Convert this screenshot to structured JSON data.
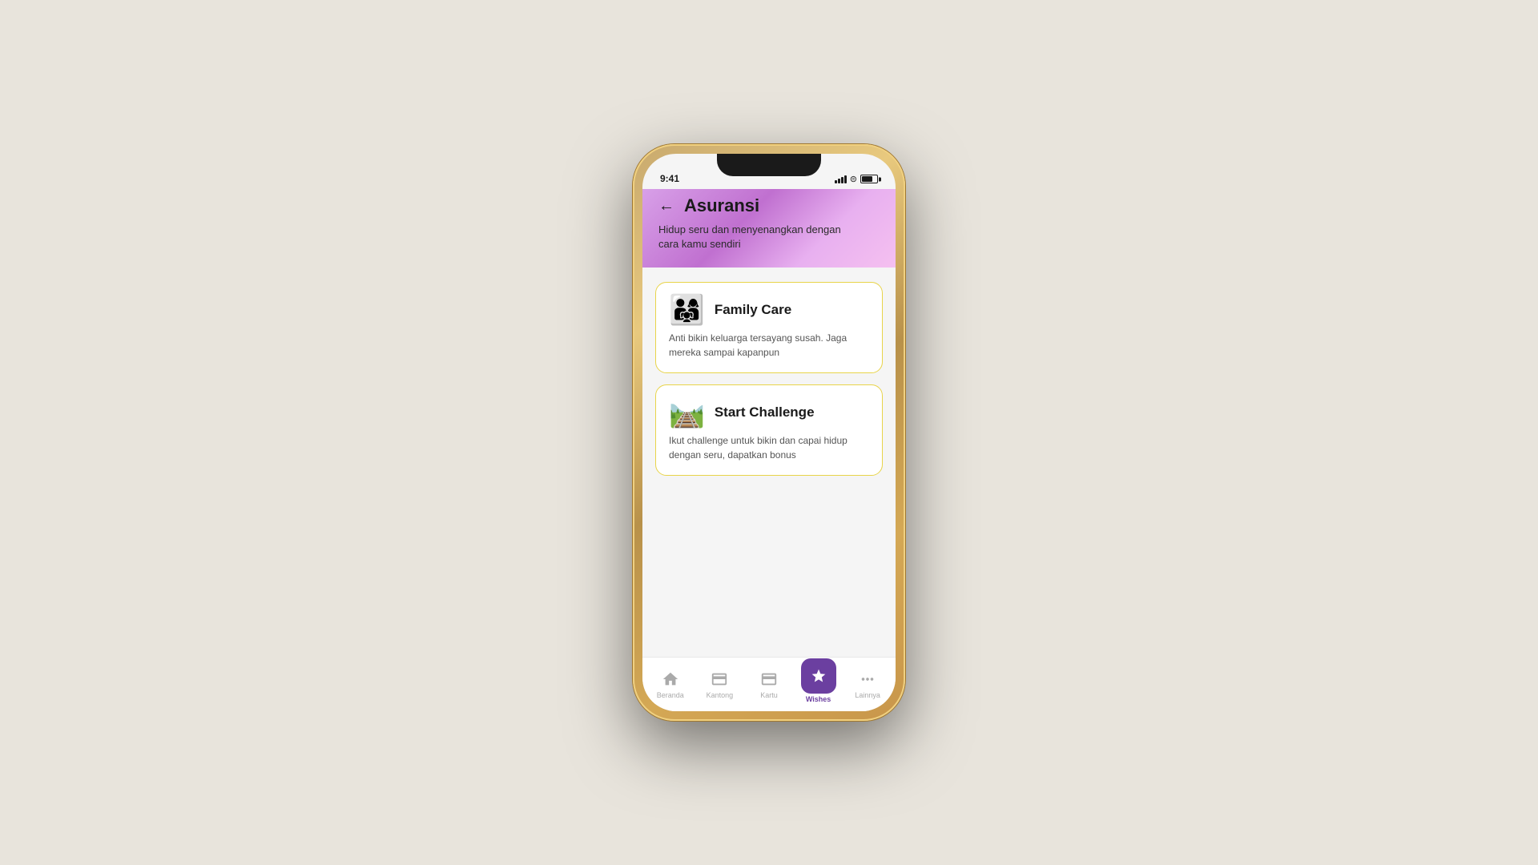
{
  "background": "#e8e4dc",
  "status_bar": {
    "time": "9:41"
  },
  "header": {
    "title": "Asuransi",
    "subtitle": "Hidup seru dan menyenangkan dengan\ncara kamu sendiri",
    "back_label": "←"
  },
  "cards": [
    {
      "id": "family-care",
      "emoji": "👨‍👩‍👧",
      "title": "Family Care",
      "description": "Anti bikin keluarga tersayang susah. Jaga mereka sampai kapanpun"
    },
    {
      "id": "start-challenge",
      "emoji": "🛤️",
      "title": "Start Challenge",
      "description": "Ikut challenge untuk bikin dan capai hidup dengan seru, dapatkan bonus"
    }
  ],
  "tab_bar": {
    "items": [
      {
        "id": "beranda",
        "label": "Beranda",
        "active": false
      },
      {
        "id": "kantong",
        "label": "Kantong",
        "active": false
      },
      {
        "id": "kartu",
        "label": "Kartu",
        "active": false
      },
      {
        "id": "wishes",
        "label": "Wishes",
        "active": true
      },
      {
        "id": "lainnya",
        "label": "Lainnya",
        "active": false
      }
    ]
  }
}
